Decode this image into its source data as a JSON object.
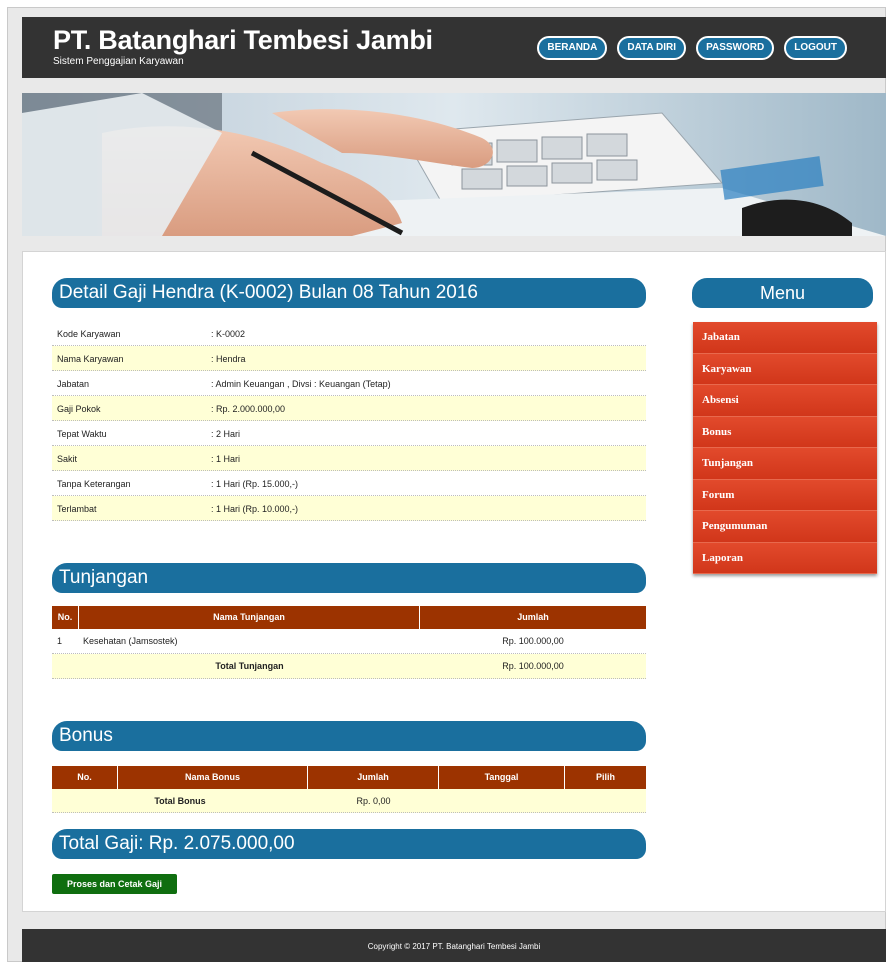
{
  "header": {
    "title": "PT. Batanghari Tembesi Jambi",
    "subtitle": "Sistem Penggajian Karyawan",
    "nav": [
      "BERANDA",
      "DATA DIRI",
      "PASSWORD",
      "LOGOUT"
    ]
  },
  "detail": {
    "heading": "Detail Gaji Hendra (K-0002) Bulan 08 Tahun 2016",
    "rows": [
      {
        "label": "Kode Karyawan",
        "value": ": K-0002"
      },
      {
        "label": "Nama Karyawan",
        "value": ": Hendra"
      },
      {
        "label": "Jabatan",
        "value": ": Admin Keuangan , Divsi : Keuangan (Tetap)"
      },
      {
        "label": "Gaji Pokok",
        "value": ": Rp. 2.000.000,00"
      },
      {
        "label": "Tepat Waktu",
        "value": ": 2 Hari"
      },
      {
        "label": "Sakit",
        "value": ": 1 Hari"
      },
      {
        "label": "Tanpa Keterangan",
        "value": ": 1 Hari (Rp. 15.000,-)"
      },
      {
        "label": "Terlambat",
        "value": ": 1 Hari (Rp. 10.000,-)"
      }
    ]
  },
  "tunjangan": {
    "heading": "Tunjangan",
    "columns": [
      "No.",
      "Nama Tunjangan",
      "Jumlah"
    ],
    "rows": [
      {
        "no": "1",
        "nama": "Kesehatan (Jamsostek)",
        "jumlah": "Rp. 100.000,00"
      }
    ],
    "total_label": "Total Tunjangan",
    "total_value": "Rp. 100.000,00"
  },
  "bonus": {
    "heading": "Bonus",
    "columns": [
      "No.",
      "Nama Bonus",
      "Jumlah",
      "Tanggal",
      "Pilih"
    ],
    "total_label": "Total Bonus",
    "total_value": "Rp. 0,00"
  },
  "total_gaji": "Total Gaji: Rp. 2.075.000,00",
  "print_button": "Proses dan Cetak Gaji",
  "menu": {
    "title": "Menu",
    "items": [
      "Jabatan",
      "Karyawan",
      "Absensi",
      "Bonus",
      "Tunjangan",
      "Forum",
      "Pengumuman",
      "Laporan"
    ]
  },
  "footer": "Copyright © 2017 PT. Batanghari Tembesi Jambi",
  "colors": {
    "header_bg": "#333333",
    "accent_blue": "#1a6f9e",
    "table_header": "#9c3300",
    "row_highlight": "#ffffd6",
    "menu_red": "#d83a1e",
    "button_green": "#0f6e0f"
  }
}
